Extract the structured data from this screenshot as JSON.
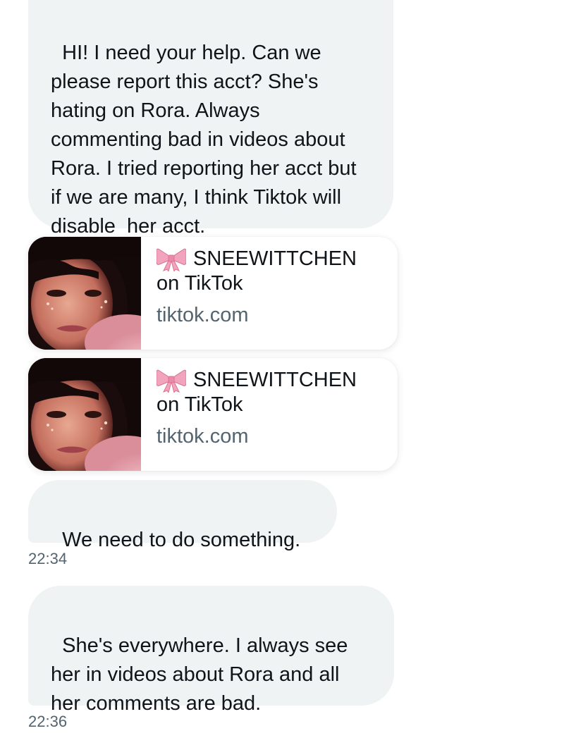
{
  "messages": [
    {
      "text": "HI! I need your help. Can we please report this acct? She's hating on Rora. Always commenting bad in videos about Rora. I tried reporting her acct but if we are many, I think Tiktok will disable  her acct."
    },
    {
      "text": "We need to do something.",
      "time": "22:34"
    },
    {
      "text": "She's everywhere. I always see her in videos about Rora and all her comments are bad.",
      "time": "22:36"
    }
  ],
  "link_cards": [
    {
      "icon": "ribbon-bow-icon",
      "title_line1": "SNEEWITTCHEN",
      "title_line2": "on TikTok",
      "domain": "tiktok.com"
    },
    {
      "icon": "ribbon-bow-icon",
      "title_line1": "SNEEWITTCHEN",
      "title_line2": "on TikTok",
      "domain": "tiktok.com"
    }
  ],
  "colors": {
    "bubble_background": "#eff3f4",
    "text_primary": "#0f1419",
    "text_secondary": "#536471",
    "bow": "#f2a3bd"
  }
}
